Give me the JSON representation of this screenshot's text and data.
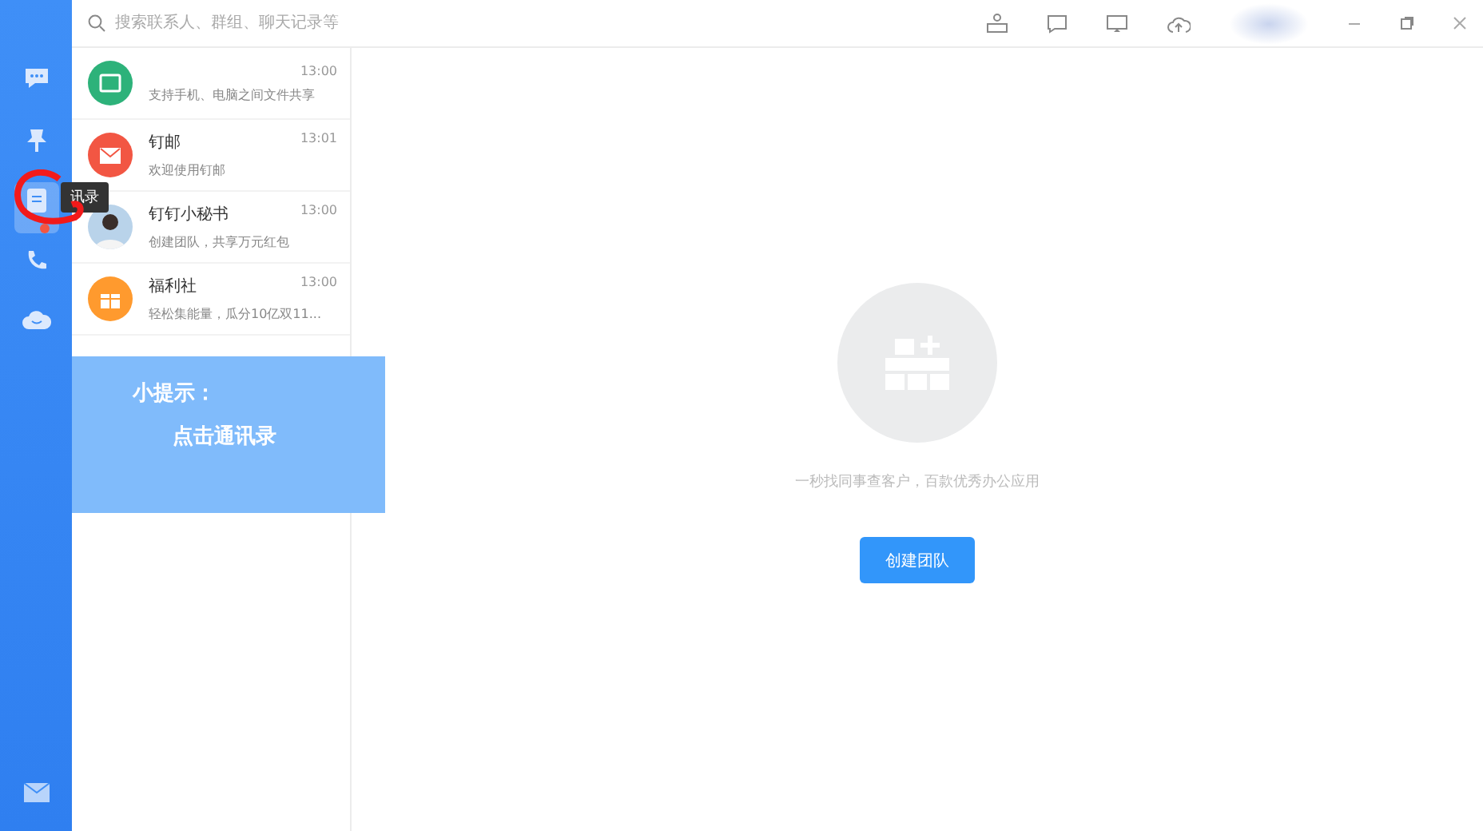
{
  "search": {
    "placeholder": "搜索联系人、群组、聊天记录等"
  },
  "nav": [
    {
      "kind": "chat",
      "selected": false,
      "badge": false
    },
    {
      "kind": "pin",
      "selected": false,
      "badge": false
    },
    {
      "kind": "contacts",
      "selected": true,
      "badge": true
    },
    {
      "kind": "phone",
      "selected": false,
      "badge": false
    },
    {
      "kind": "cloud",
      "selected": false,
      "badge": false
    }
  ],
  "tooltip": "讯录",
  "conversations": [
    {
      "kind": "file",
      "time": "13:00",
      "preview": "支持手机、电脑之间文件共享"
    },
    {
      "kind": "mail",
      "title": "钉邮",
      "time": "13:01",
      "preview": "欢迎使用钉邮"
    },
    {
      "kind": "person",
      "title": "钉钉小秘书",
      "time": "13:00",
      "preview": "创建团队，共享万元红包"
    },
    {
      "kind": "gift",
      "title": "福利社",
      "time": "13:00",
      "preview": "轻松集能量，瓜分10亿双11..."
    }
  ],
  "hint": {
    "title": "小提示：",
    "body": "点击通讯录"
  },
  "empty": {
    "text": "一秒找同事查客户，百款优秀办公应用",
    "button": "创建团队"
  }
}
